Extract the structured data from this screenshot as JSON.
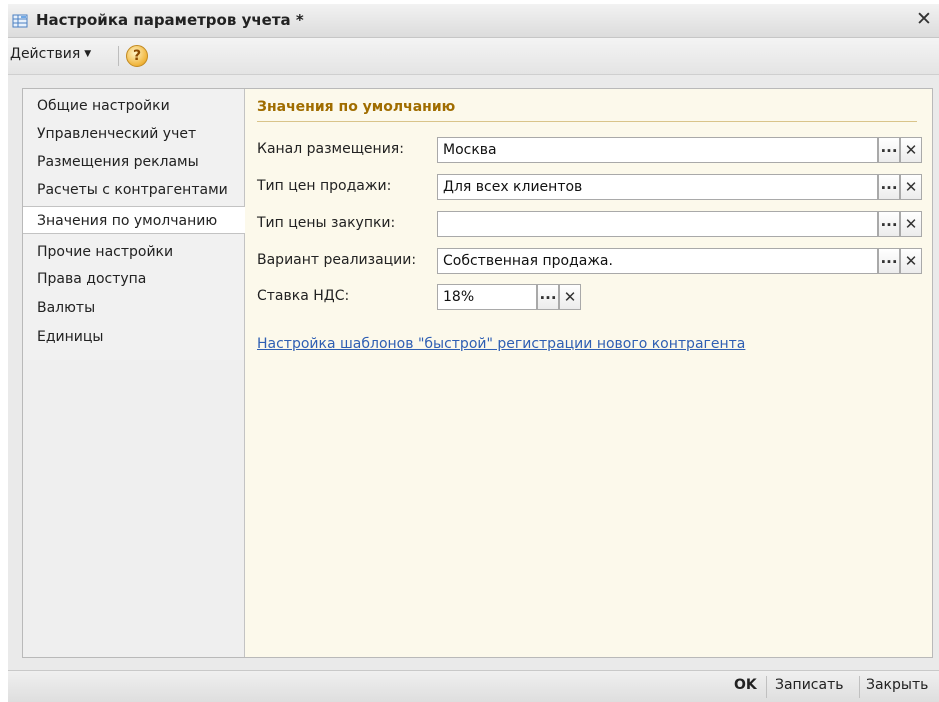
{
  "window": {
    "title": "Настройка параметров учета *",
    "close_glyph": "✕"
  },
  "toolbar": {
    "actions_label": "Действия",
    "actions_arrow": "▼",
    "help_label": "?"
  },
  "nav": {
    "items": [
      {
        "label": "Общие настройки"
      },
      {
        "label": "Управленческий учет"
      },
      {
        "label": "Размещения рекламы"
      },
      {
        "label": "Расчеты с контрагентами"
      },
      {
        "label": "Значения по умолчанию",
        "active": true
      },
      {
        "label": "Прочие настройки"
      },
      {
        "label": "Права доступа"
      },
      {
        "label": "Валюты"
      },
      {
        "label": "Единицы"
      }
    ]
  },
  "panel": {
    "section_title": "Значения по умолчанию",
    "fields": [
      {
        "label": "Канал размещения:",
        "value": "Москва"
      },
      {
        "label": "Тип цен продажи:",
        "value": "Для всех клиентов"
      },
      {
        "label": "Тип цены закупки:",
        "value": ""
      },
      {
        "label": "Вариант реализации:",
        "value": "Собственная продажа."
      },
      {
        "label": "Ставка НДС:",
        "value": "18%"
      }
    ],
    "select_glyph": "...",
    "clear_glyph": "✕",
    "link_text": "Настройка шаблонов \"быстрой\" регистрации нового контрагента"
  },
  "footer": {
    "ok_label": "OK",
    "save_label": "Записать",
    "close_label": "Закрыть"
  },
  "colors": {
    "section_title": "#a06d00",
    "link": "#2f5fb3",
    "panel_bg": "#fcf9eb",
    "help_icon": "#f0b43a"
  },
  "icons": {
    "app": "table-settings-icon",
    "help": "help-icon",
    "close": "close-icon"
  }
}
